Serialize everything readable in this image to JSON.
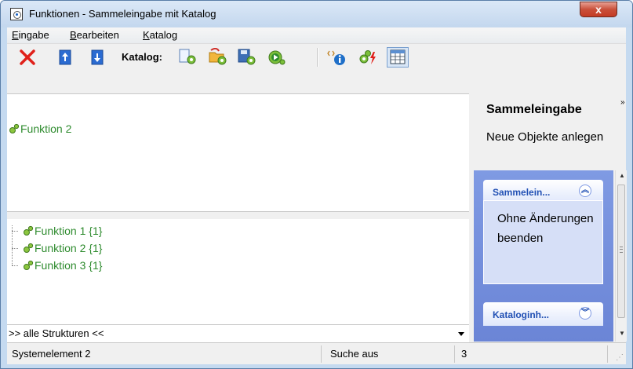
{
  "window": {
    "title": "Funktionen - Sammeleingabe mit Katalog",
    "close_label": "x"
  },
  "menu": {
    "items": [
      {
        "label": "Eingabe"
      },
      {
        "label": "Bearbeiten"
      },
      {
        "label": "Katalog"
      }
    ]
  },
  "toolbar": {
    "katalog_label": "Katalog:",
    "icons": [
      "delete-icon",
      "move-up-icon",
      "move-down-icon",
      "catalog-new-icon",
      "catalog-open-icon",
      "catalog-save-icon",
      "catalog-run-icon",
      "info-icon",
      "function-flash-icon",
      "table-view-icon"
    ]
  },
  "upper": {
    "header_value": "",
    "nodes": [
      {
        "label": "Funktion 2"
      }
    ]
  },
  "lower": {
    "tree": [
      {
        "label": "Funktion 1 {1}"
      },
      {
        "label": "Funktion 2 {1}"
      },
      {
        "label": "Funktion 3 {1}"
      }
    ],
    "structure_select": ">> alle Strukturen <<"
  },
  "right_panel": {
    "title": "Sammeleingabe",
    "subtitle": "Neue Objekte anlegen",
    "groups": [
      {
        "label": "Sammelein...",
        "state": "expanded",
        "link": "Ohne Änderungen beenden"
      },
      {
        "label": "Kataloginh...",
        "state": "collapsed"
      }
    ]
  },
  "status": {
    "element": "Systemelement 2",
    "search": "Suche aus",
    "count": "3"
  },
  "colors": {
    "function_green": "#2e8b2e",
    "task_pane_blue": "#7f9ae3",
    "group_header_text": "#2150b4",
    "delete_red": "#e0201a"
  }
}
